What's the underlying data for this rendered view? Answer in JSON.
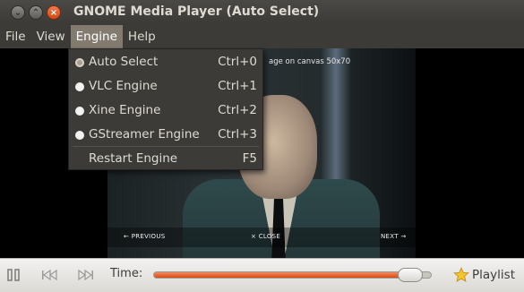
{
  "window": {
    "title": "GNOME Media Player (Auto Select)",
    "buttons": [
      "minimize-icon",
      "maximize-icon",
      "close-icon"
    ]
  },
  "menubar": {
    "items": [
      {
        "label": "File"
      },
      {
        "label": "View"
      },
      {
        "label": "Engine",
        "active": true
      },
      {
        "label": "Help"
      }
    ]
  },
  "engine_menu": {
    "items": [
      {
        "label": "Auto Select",
        "accel": "Ctrl+0",
        "selected": true
      },
      {
        "label": "VLC Engine",
        "accel": "Ctrl+1"
      },
      {
        "label": "Xine Engine",
        "accel": "Ctrl+2"
      },
      {
        "label": "GStreamer Engine",
        "accel": "Ctrl+3"
      },
      {
        "label": "Restart Engine",
        "accel": "F5"
      }
    ]
  },
  "video": {
    "caption": "age on canvas 50x70",
    "nav_previous": "← PREVIOUS",
    "nav_close": "× CLOSE",
    "nav_next": "NEXT →"
  },
  "controls": {
    "time_label": "Time:",
    "playlist_label": "Playlist",
    "progress": 0.96,
    "accent": "#dd4814"
  }
}
